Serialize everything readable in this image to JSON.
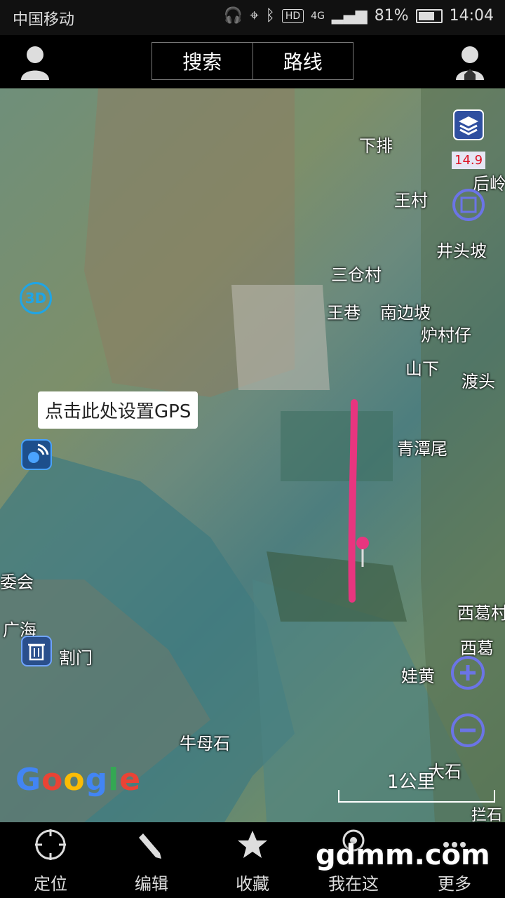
{
  "status_bar": {
    "carrier": "中国移动",
    "hd": "HD",
    "network": "4G",
    "battery": "81%",
    "time": "14:04"
  },
  "top_bar": {
    "search_label": "搜索",
    "route_label": "路线"
  },
  "map": {
    "zoom_level": "14.9",
    "three_d_label": "3D",
    "gps_tooltip": "点击此处设置GPS",
    "scale_label": "1公里",
    "logo": "Google",
    "place_labels": [
      "下排",
      "后岭",
      "王村",
      "井头坡",
      "三仓村",
      "王巷",
      "南边坡",
      "炉村仔",
      "山下",
      "渡头",
      "青潭尾",
      "委会",
      "西葛村",
      "广海",
      "割门",
      "西葛",
      "娃黄",
      "牛母石",
      "大石",
      "拦石"
    ],
    "route_color": "#e8357f"
  },
  "bottom_nav": {
    "items": [
      {
        "label": "定位"
      },
      {
        "label": "编辑"
      },
      {
        "label": "收藏"
      },
      {
        "label": "我在这"
      },
      {
        "label": "更多"
      }
    ]
  },
  "watermark": "gdmm.com"
}
